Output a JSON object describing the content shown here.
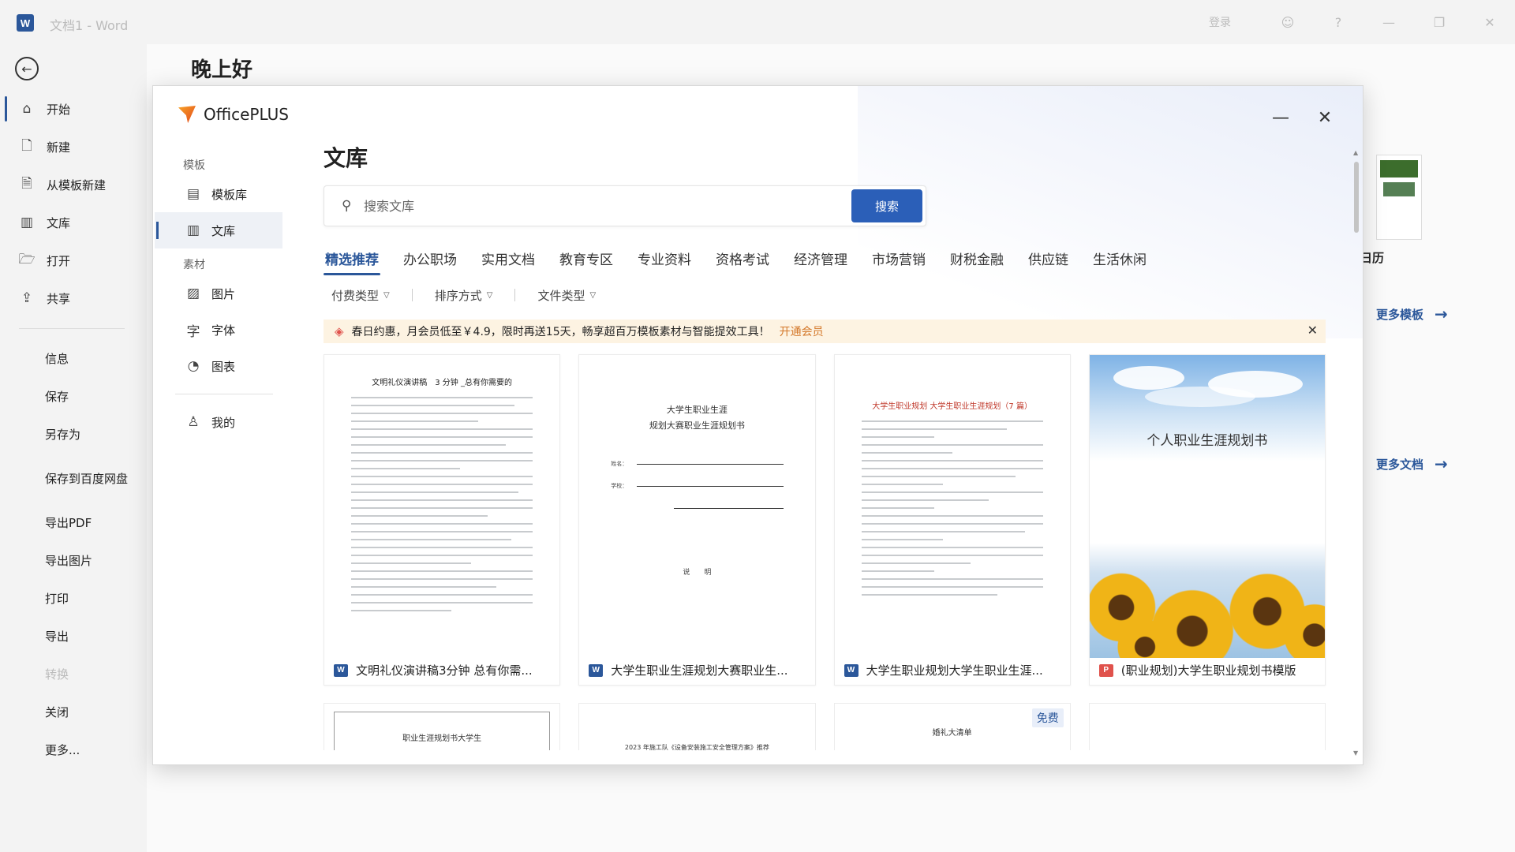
{
  "window": {
    "app_title": "文档1 - Word",
    "login_label": "登录",
    "logo_letter": "W"
  },
  "backstage": {
    "greeting": "晚上好",
    "nav_top": [
      {
        "label": "开始",
        "icon": "home-icon",
        "glyph": "⌂"
      },
      {
        "label": "新建",
        "icon": "new-document-icon",
        "glyph": "🗋"
      },
      {
        "label": "从模板新建",
        "icon": "template-document-icon",
        "glyph": "🗎"
      },
      {
        "label": "文库",
        "icon": "library-icon",
        "glyph": "▥"
      },
      {
        "label": "打开",
        "icon": "folder-open-icon",
        "glyph": "🗁"
      },
      {
        "label": "共享",
        "icon": "share-icon",
        "glyph": "⇪"
      }
    ],
    "nav_bottom": [
      {
        "label": "信息"
      },
      {
        "label": "保存"
      },
      {
        "label": "另存为"
      },
      {
        "label": "保存到百度网盘"
      },
      {
        "label": "导出PDF"
      },
      {
        "label": "导出图片"
      },
      {
        "label": "打印"
      },
      {
        "label": "导出"
      },
      {
        "label": "转换"
      },
      {
        "label": "关闭"
      },
      {
        "label": "更多..."
      }
    ],
    "right_label": "日历",
    "more_templates": "更多模板",
    "more_documents": "更多文档"
  },
  "dialog": {
    "brand": "OfficePLUS",
    "side": {
      "group1": "模板",
      "item_templates": "模板库",
      "item_library": "文库",
      "group2": "素材",
      "item_images": "图片",
      "item_fonts": "字体",
      "item_charts": "图表",
      "item_mine": "我的"
    },
    "title": "文库",
    "search": {
      "placeholder": "搜索文库",
      "button": "搜索"
    },
    "tabs": [
      "精选推荐",
      "办公职场",
      "实用文档",
      "教育专区",
      "专业资料",
      "资格考试",
      "经济管理",
      "市场营销",
      "财税金融",
      "供应链",
      "生活休闲"
    ],
    "filters": {
      "pay": "付费类型",
      "sort": "排序方式",
      "file": "文件类型"
    },
    "promo": {
      "text": "春日约惠，月会员低至￥4.9，限时再送15天，畅享超百万模板素材与智能提效工具！",
      "link": "开通会员"
    },
    "cards": [
      {
        "title": "文明礼仪演讲稿3分钟 总有你需...",
        "type": "W",
        "preview_heading": "文明礼仪演讲稿　3 分钟 _总有你需要的"
      },
      {
        "title": "大学生职业生涯规划大赛职业生...",
        "type": "W",
        "cover_line1": "大学生职业生涯",
        "cover_line2": "规划大赛职业生涯规划书",
        "field1": "姓名：",
        "field2": "学校：",
        "cover_footer": "说　　明"
      },
      {
        "title": "大学生职业规划大学生职业生涯...",
        "type": "W",
        "preview_heading": "大学生职业规划 大学生职业生涯规划（7 篇）"
      },
      {
        "title": "(职业规划)大学生职业规划书模版",
        "type": "P",
        "cover_title": "个人职业生涯规划书"
      }
    ],
    "row2": [
      {
        "preview": "职业生涯规划书大学生"
      },
      {
        "preview": "2023 年施工队《设备安装施工安全管理方案》推荐"
      },
      {
        "preview": "婚礼大清单",
        "badge": "免费"
      },
      {
        "preview": ""
      }
    ]
  }
}
